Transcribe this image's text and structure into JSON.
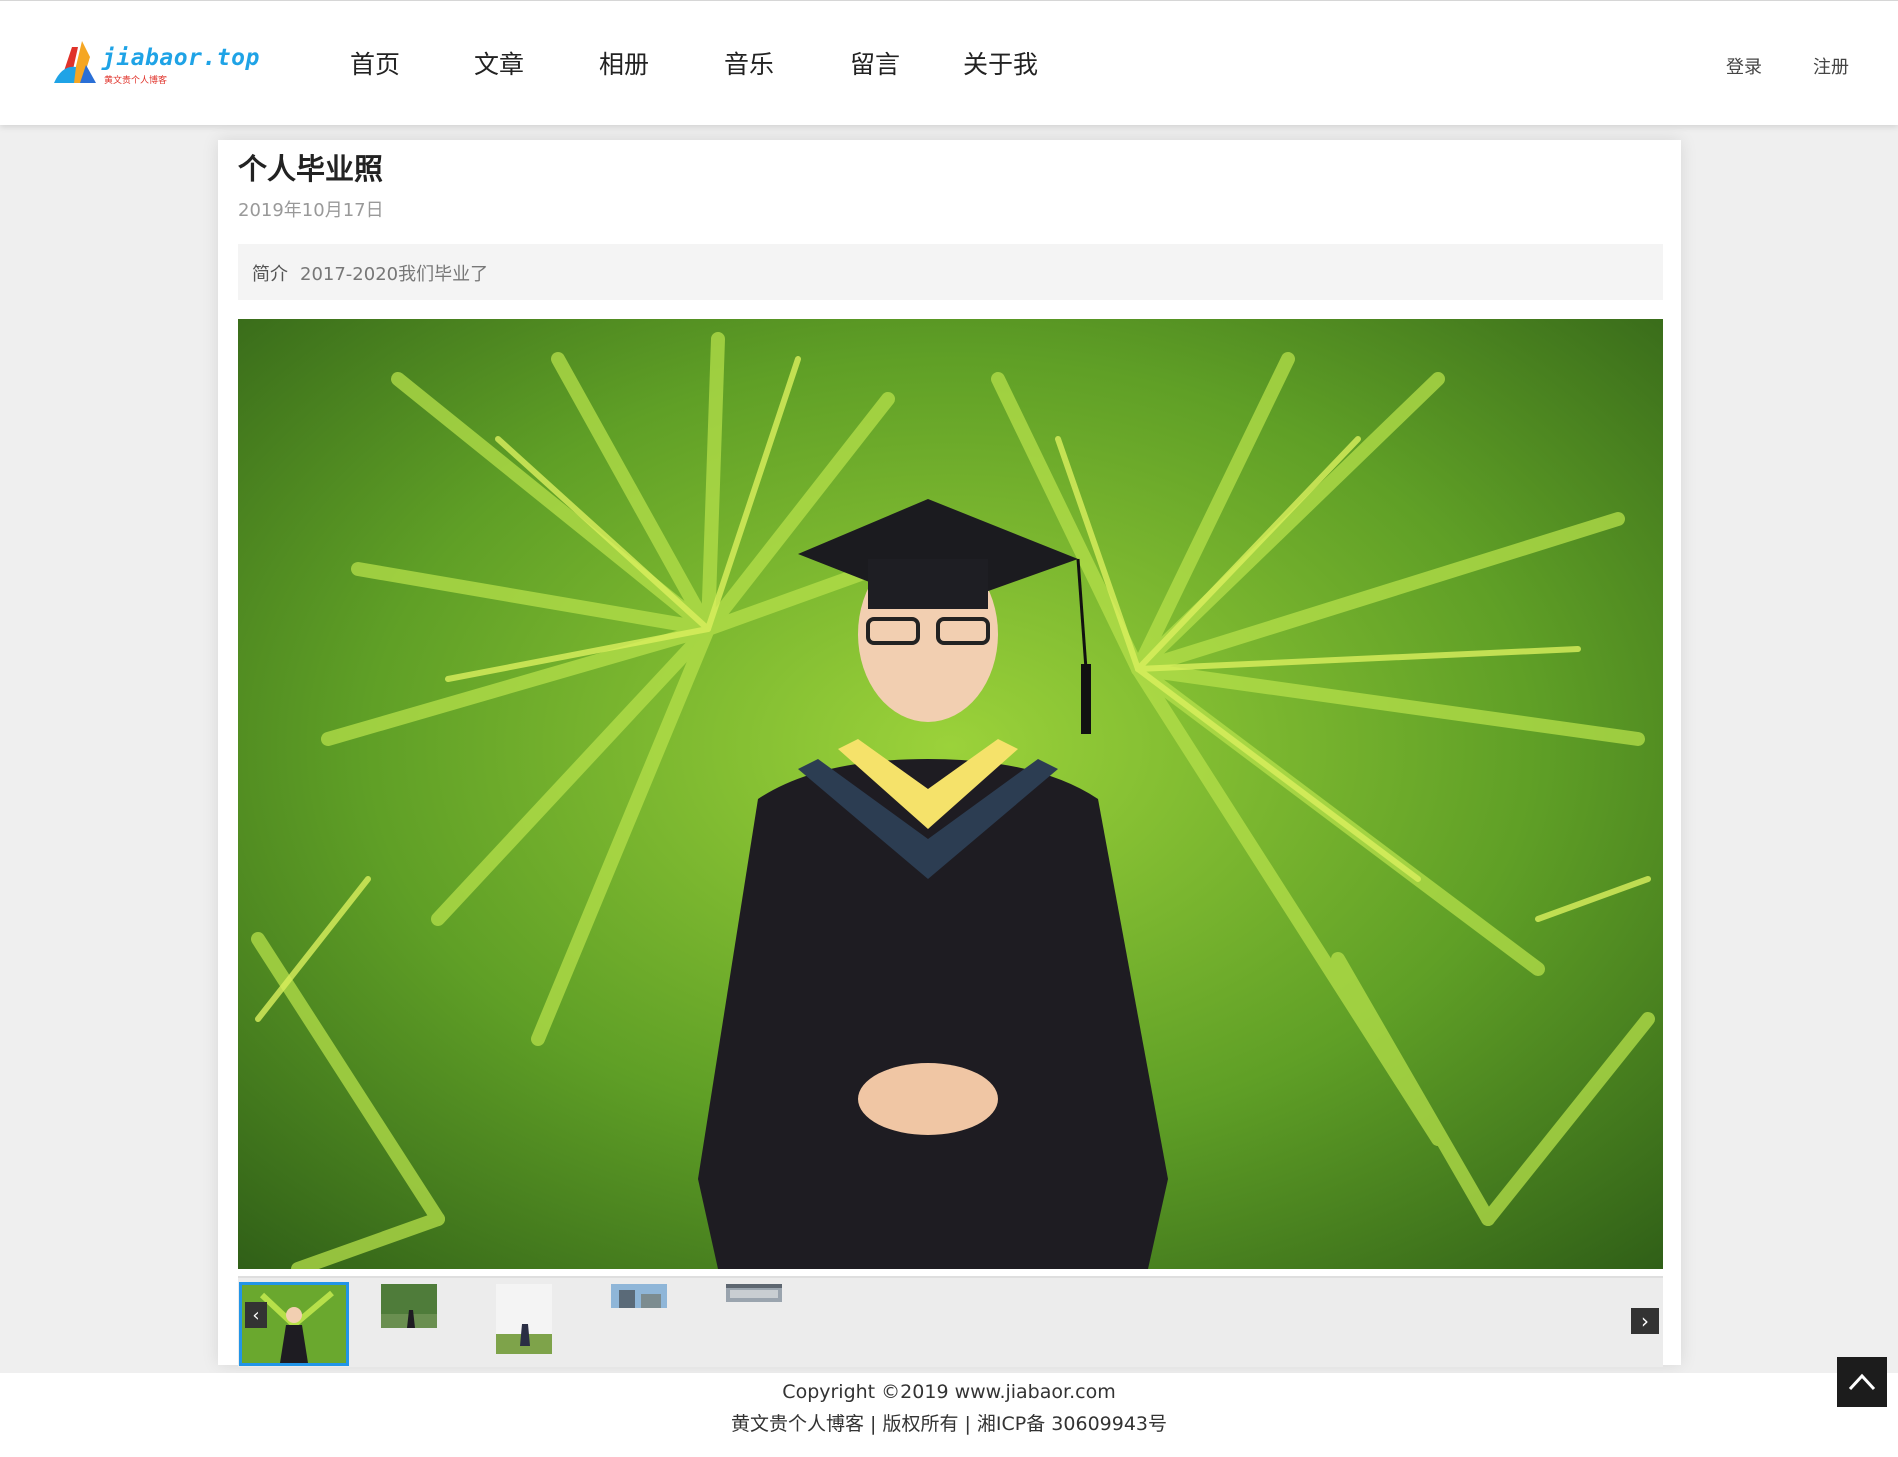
{
  "header": {
    "logo_text": "jiabaor.top",
    "logo_sub": "黄文贵个人博客",
    "nav": [
      "首页",
      "文章",
      "相册",
      "音乐",
      "留言",
      "关于我"
    ],
    "login": "登录",
    "register": "注册"
  },
  "article": {
    "title": "个人毕业照",
    "date": "2019年10月17日",
    "intro_label": "简介",
    "intro_text": "2017-2020我们毕业了"
  },
  "gallery": {
    "selected_index": 0,
    "thumbnail_count": 5
  },
  "footer": {
    "line1": "Copyright ©2019  www.jiabaor.com",
    "line2": "黄文贵个人博客 | 版权所有 | 湘ICP备 30609943号"
  },
  "colors": {
    "accent": "#2295e8",
    "logo_blue": "#1fa3e6",
    "logo_red": "#e0322a"
  }
}
